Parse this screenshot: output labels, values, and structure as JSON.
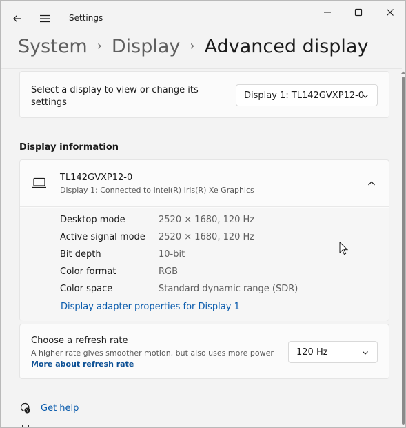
{
  "window": {
    "app_title": "Settings",
    "back_icon": "arrow-left-icon",
    "menu_icon": "hamburger-menu-icon"
  },
  "breadcrumb": {
    "items": [
      "System",
      "Display"
    ],
    "current": "Advanced display",
    "separator": "›"
  },
  "display_select": {
    "label": "Select a display to view or change its settings",
    "selected": "Display 1: TL142GVXP12-0"
  },
  "display_info": {
    "section_title": "Display information",
    "name": "TL142GVXP12-0",
    "subtitle": "Display 1: Connected to Intel(R) Iris(R) Xe Graphics",
    "rows": [
      {
        "key": "Desktop mode",
        "value": "2520 × 1680, 120 Hz"
      },
      {
        "key": "Active signal mode",
        "value": "2520 × 1680, 120 Hz"
      },
      {
        "key": "Bit depth",
        "value": "10-bit"
      },
      {
        "key": "Color format",
        "value": "RGB"
      },
      {
        "key": "Color space",
        "value": "Standard dynamic range (SDR)"
      }
    ],
    "adapter_link": "Display adapter properties for Display 1"
  },
  "refresh_rate": {
    "title": "Choose a refresh rate",
    "subtitle": "A higher rate gives smoother motion, but also uses more power",
    "link": "More about refresh rate",
    "selected": "120 Hz"
  },
  "help": {
    "label": "Get help"
  },
  "colors": {
    "accent": "#0b5cad",
    "background": "#f3f3f3",
    "card": "#fbfbfb"
  }
}
